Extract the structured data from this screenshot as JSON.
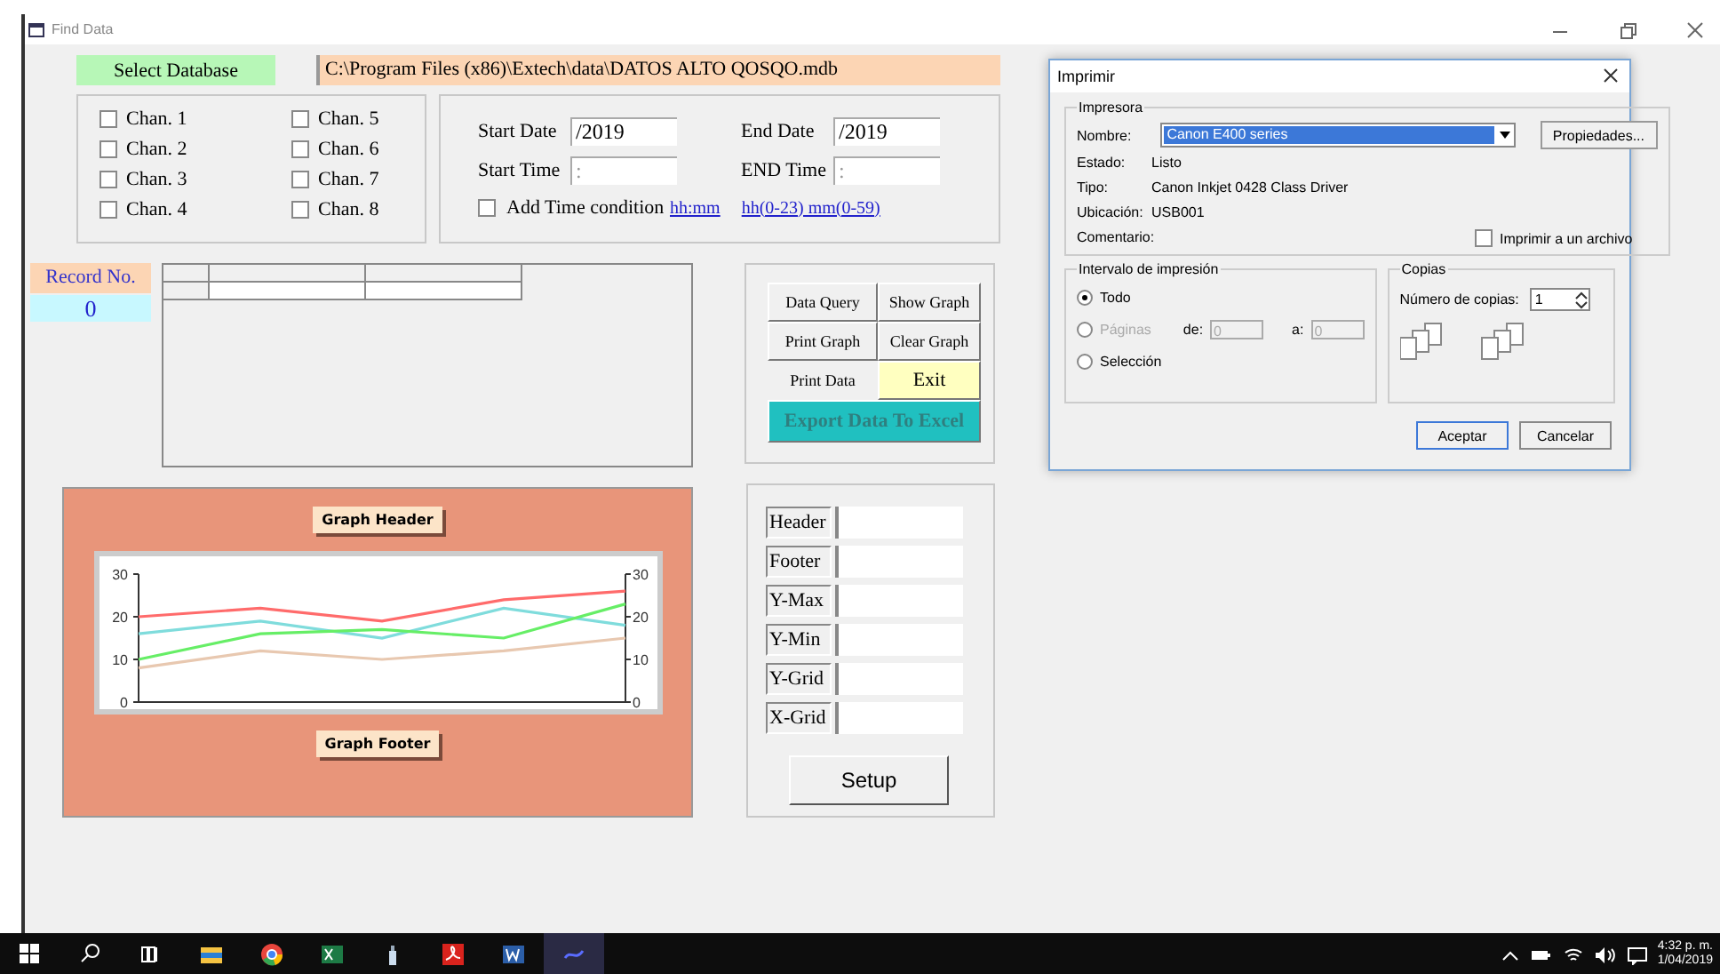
{
  "window": {
    "title": "Find Data"
  },
  "database": {
    "button": "Select Database",
    "path": "C:\\Program Files (x86)\\Extech\\data\\DATOS ALTO QOSQO.mdb"
  },
  "channels": [
    {
      "label": "Chan. 1",
      "checked": false
    },
    {
      "label": "Chan. 2",
      "checked": false
    },
    {
      "label": "Chan. 3",
      "checked": false
    },
    {
      "label": "Chan. 4",
      "checked": false
    },
    {
      "label": "Chan. 5",
      "checked": false
    },
    {
      "label": "Chan. 6",
      "checked": false
    },
    {
      "label": "Chan. 7",
      "checked": false
    },
    {
      "label": "Chan. 8",
      "checked": false
    }
  ],
  "date_filter": {
    "start_date_label": "Start Date",
    "start_date": "/2019",
    "end_date_label": "End Date",
    "end_date": "/2019",
    "start_time_label": "Start Time",
    "start_time": " :",
    "end_time_label": "END Time",
    "end_time": " :",
    "time_condition": {
      "label": "Add Time condition",
      "checked": false
    },
    "hints": [
      "hh:mm",
      "hh(0-23) mm(0-59)"
    ]
  },
  "record": {
    "label": "Record No.",
    "value": "0"
  },
  "actions": [
    {
      "label": "Data Query",
      "kind": "plain",
      "disabled": false
    },
    {
      "label": "Show Graph",
      "kind": "plain",
      "disabled": false
    },
    {
      "label": "Print Graph",
      "kind": "plain",
      "disabled": false
    },
    {
      "label": "Clear Graph",
      "kind": "plain",
      "disabled": false
    },
    {
      "label": "Print Data",
      "kind": "flat",
      "disabled": false
    },
    {
      "label": "Exit",
      "kind": "exit",
      "disabled": false
    },
    {
      "label": "Export Data To Excel",
      "kind": "export",
      "disabled": true
    }
  ],
  "graph": {
    "header": "Graph Header",
    "footer": "Graph Footer",
    "right_axis_labels": [
      "30",
      "20",
      "10",
      "0"
    ],
    "chart_data": {
      "type": "line",
      "ylim": [
        0,
        30
      ],
      "yticks": [
        0,
        10,
        20,
        30
      ],
      "series": [
        {
          "color": "#ff6b6b",
          "values": [
            20,
            22,
            19,
            24,
            26
          ]
        },
        {
          "color": "#7fdcdc",
          "values": [
            16,
            19,
            15,
            22,
            18
          ]
        },
        {
          "color": "#66ee66",
          "values": [
            10,
            16,
            17,
            15,
            23
          ]
        },
        {
          "color": "#e8c8b0",
          "values": [
            8,
            12,
            10,
            12,
            15
          ]
        }
      ]
    }
  },
  "graph_settings": {
    "fields": [
      {
        "label": "Header"
      },
      {
        "label": "Footer"
      },
      {
        "label": "Y-Max"
      },
      {
        "label": "Y-Min"
      },
      {
        "label": "Y-Grid"
      },
      {
        "label": "X-Grid"
      }
    ],
    "button": "Setup"
  },
  "print_dialog": {
    "title": "Imprimir",
    "printer_group": "Impresora",
    "name_label": "Nombre:",
    "printer": "Canon E400 series",
    "properties_button": "Propiedades...",
    "info": [
      {
        "label": "Estado:",
        "value": "Listo"
      },
      {
        "label": "Tipo:",
        "value": "Canon Inkjet 0428 Class Driver"
      },
      {
        "label": "Ubicación:",
        "value": "USB001"
      },
      {
        "label": "Comentario:"
      }
    ],
    "print_to_file": {
      "label": "Imprimir a un archivo",
      "checked": false
    },
    "range_group": "Intervalo de impresión",
    "range": [
      {
        "label": "Todo",
        "selected": true,
        "disabled": false
      },
      {
        "label": "Páginas",
        "selected": false,
        "disabled": true
      },
      {
        "label": "Selección",
        "selected": false,
        "disabled": false
      }
    ],
    "from_label": "de:",
    "from": "0",
    "to_label": "a:",
    "to": "0",
    "copies_group": "Copias",
    "copies_label": "Número de copias:",
    "copies": "1",
    "buttons": [
      "Aceptar",
      "Cancelar"
    ]
  },
  "taskbar": {
    "time": "4:32 p. m.",
    "date": "1/04/2019"
  }
}
